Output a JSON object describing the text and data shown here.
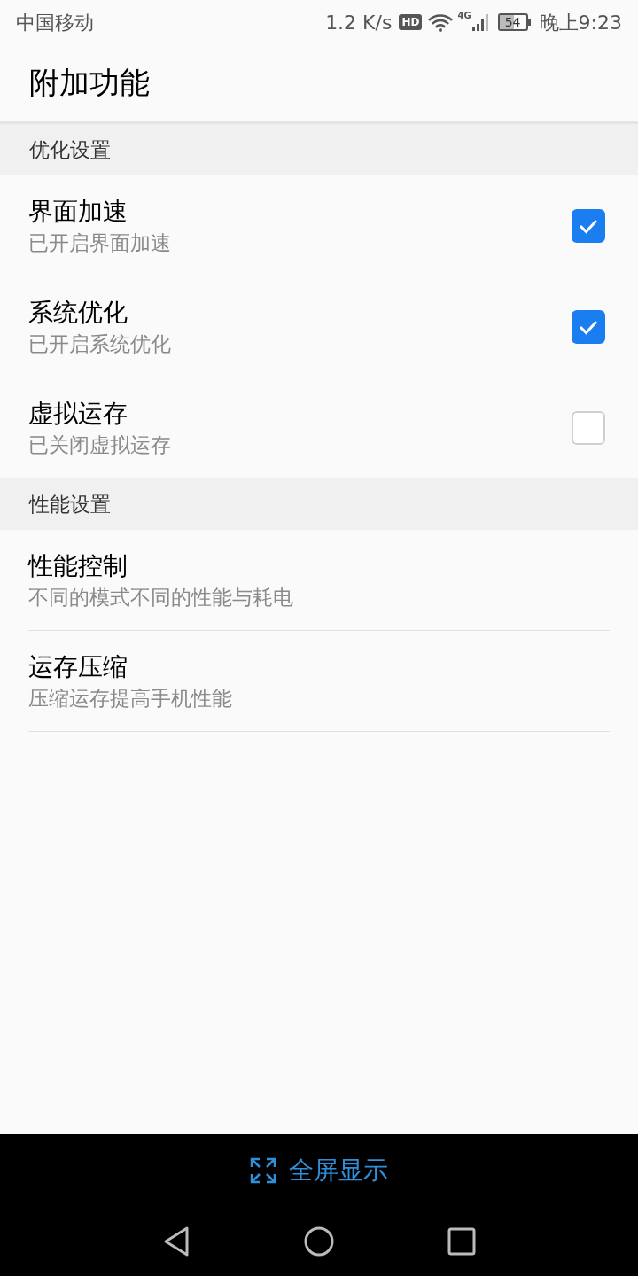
{
  "status_bar": {
    "carrier": "中国移动",
    "speed": "1.2 K/s",
    "hd": "HD",
    "network": "4G",
    "battery": "54",
    "time": "晚上9:23"
  },
  "title": "附加功能",
  "sections": [
    {
      "header": "优化设置",
      "items": [
        {
          "kind": "checkbox",
          "title": "界面加速",
          "subtitle": "已开启界面加速",
          "checked": true
        },
        {
          "kind": "checkbox",
          "title": "系统优化",
          "subtitle": "已开启系统优化",
          "checked": true
        },
        {
          "kind": "checkbox",
          "title": "虚拟运存",
          "subtitle": "已关闭虚拟运存",
          "checked": false
        }
      ]
    },
    {
      "header": "性能设置",
      "items": [
        {
          "kind": "link",
          "title": "性能控制",
          "subtitle": "不同的模式不同的性能与耗电"
        },
        {
          "kind": "link",
          "title": "运存压缩",
          "subtitle": "压缩运存提高手机性能"
        }
      ]
    }
  ],
  "fullscreen_button": "全屏显示"
}
